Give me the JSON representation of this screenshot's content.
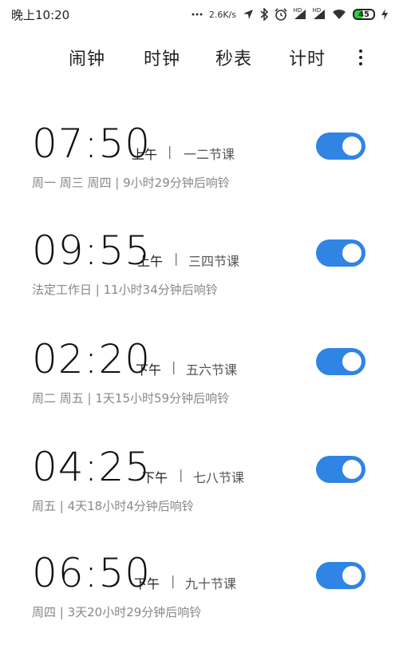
{
  "status_bar": {
    "time": "晚上10:20",
    "speed": "2.6K/s",
    "battery": "45",
    "hd1": "HD",
    "hd2": "HD",
    "icons": [
      "signal-dots-icon",
      "location-icon",
      "bluetooth-icon",
      "alarm-icon",
      "signal-icon",
      "signal-icon",
      "wifi-icon",
      "battery-icon",
      "charging-icon"
    ]
  },
  "tabs": [
    {
      "label": "闹钟",
      "active": true
    },
    {
      "label": "时钟",
      "active": false
    },
    {
      "label": "秒表",
      "active": false
    },
    {
      "label": "计时",
      "active": false
    }
  ],
  "alarms": [
    {
      "time": "07:50",
      "ampm": "上午",
      "label": "一二节课",
      "sub": "周一 周三 周四 | 9小时29分钟后响铃",
      "enabled": true
    },
    {
      "time": "09:55",
      "ampm": "上午",
      "label": "三四节课",
      "sub": "法定工作日 | 11小时34分钟后响铃",
      "enabled": true
    },
    {
      "time": "02:20",
      "ampm": "下午",
      "label": "五六节课",
      "sub": "周二 周五 | 1天15小时59分钟后响铃",
      "enabled": true
    },
    {
      "time": "04:25",
      "ampm": "下午",
      "label": "七八节课",
      "sub": "周五 | 4天18小时4分钟后响铃",
      "enabled": true
    },
    {
      "time": "06:50",
      "ampm": "下午",
      "label": "九十节课",
      "sub": "周四 | 3天20小时29分钟后响铃",
      "enabled": true
    }
  ],
  "colors": {
    "accent": "#3a87d6",
    "toggle_on": "#2f84e4"
  }
}
